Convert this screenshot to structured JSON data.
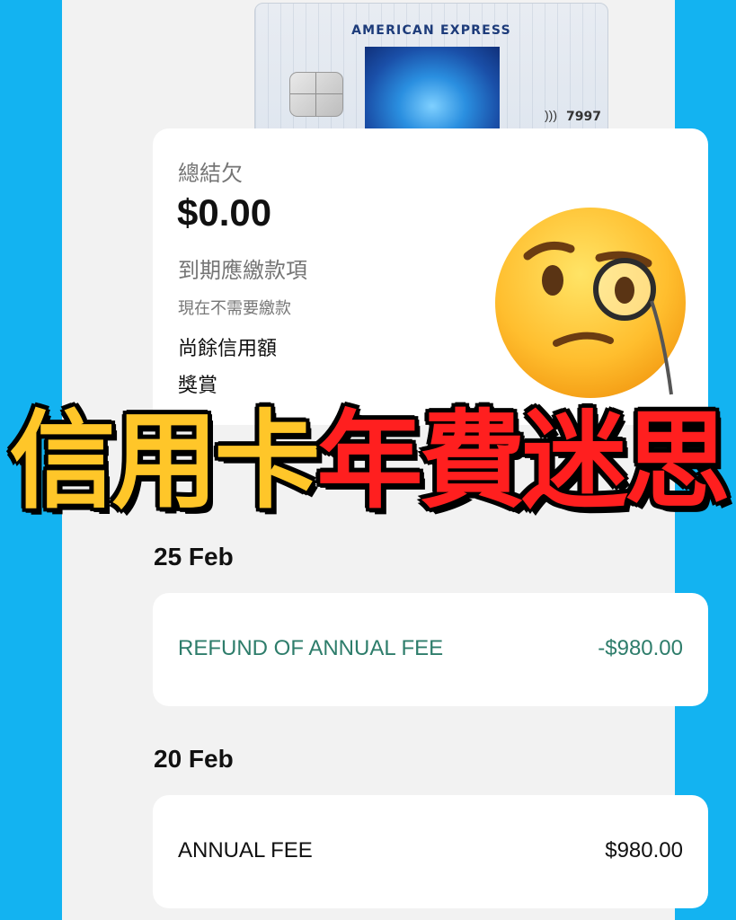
{
  "card": {
    "brand": "AMERICAN EXPRESS",
    "last_digits": "7997",
    "contactless_symbol": ")))"
  },
  "summary": {
    "total_balance_label": "總結欠",
    "total_balance_value": "$0.00",
    "payment_due_label": "到期應繳款項",
    "payment_due_status": "現在不需要繳款",
    "available_credit_label": "尚餘信用額",
    "rewards_label": "獎賞"
  },
  "headline": {
    "part1": "信用卡",
    "part2": "年費迷思"
  },
  "transactions": [
    {
      "date": "25 Feb",
      "description": "REFUND OF ANNUAL FEE",
      "amount": "-$980.00",
      "color": "#2e7d6b"
    },
    {
      "date": "20 Feb",
      "description": "ANNUAL FEE",
      "amount": "$980.00",
      "color": "#111111"
    }
  ],
  "colors": {
    "background": "#13b3f1",
    "headline_yellow": "#ffc629",
    "headline_red": "#ff1f1f",
    "refund_green": "#2e7d6b"
  },
  "icons": [
    "monocle-face-icon",
    "contactless-icon",
    "card-chip-icon"
  ]
}
